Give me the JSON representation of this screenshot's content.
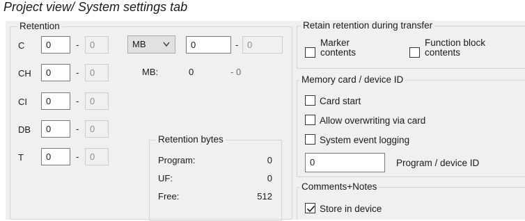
{
  "caption": "Project view/ System settings tab",
  "retention": {
    "title": "Retention",
    "rows": [
      {
        "label": "C",
        "from": "0",
        "to": "0"
      },
      {
        "label": "CH",
        "from": "0",
        "to": "0"
      },
      {
        "label": "CI",
        "from": "0",
        "to": "0"
      },
      {
        "label": "DB",
        "from": "0",
        "to": "0"
      },
      {
        "label": "T",
        "from": "0",
        "to": "0"
      }
    ],
    "dash": "-",
    "marker_type": {
      "selected": "MB"
    },
    "marker_from": "0",
    "marker_to": "0",
    "mb_summary": {
      "label": "MB:",
      "from": "0",
      "to": "- 0"
    },
    "bytes": {
      "title": "Retention bytes",
      "program_label": "Program:",
      "program_value": "0",
      "uf_label": "UF:",
      "uf_value": "0",
      "free_label": "Free:",
      "free_value": "512"
    }
  },
  "transfer": {
    "title": "Retain retention during transfer",
    "marker_label_1": "Marker",
    "marker_label_2": "contents",
    "marker_checked": false,
    "fb_label_1": "Function block",
    "fb_label_2": "contents",
    "fb_checked": false
  },
  "memory": {
    "title": "Memory card / device ID",
    "card_start": "Card start",
    "allow_overwrite": "Allow overwriting via card",
    "event_logging": "System event logging",
    "device_id_value": "0",
    "device_id_label": "Program / device ID"
  },
  "comments": {
    "title": "Comments+Notes",
    "store_in_device": "Store in device",
    "store_checked": true
  }
}
